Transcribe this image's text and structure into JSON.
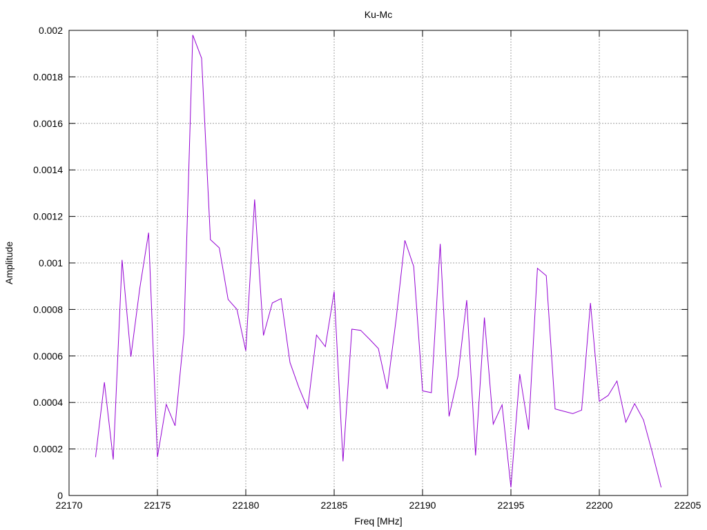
{
  "chart_data": {
    "type": "line",
    "title": "Ku-Mc",
    "xlabel": "Freq [MHz]",
    "ylabel": "Amplitude",
    "xlim": [
      22170,
      22205
    ],
    "ylim": [
      0,
      0.002
    ],
    "x_ticks": [
      "22170",
      "22175",
      "22180",
      "22185",
      "22190",
      "22195",
      "22200",
      "22205"
    ],
    "y_ticks": [
      "0",
      "0.0002",
      "0.0004",
      "0.0006",
      "0.0008",
      "0.001",
      "0.0012",
      "0.0014",
      "0.0016",
      "0.0018",
      "0.002"
    ],
    "grid": true,
    "legend": "none",
    "line_color": "#9400d3",
    "series": [
      {
        "x": [
          22171.5,
          22172,
          22172.5,
          22173,
          22173.5,
          22174,
          22174.5,
          22175,
          22175.5,
          22176,
          22176.5,
          22177,
          22177.5,
          22178,
          22178.5,
          22179,
          22179.5,
          22180,
          22180.5,
          22181,
          22181.5,
          22182,
          22182.5,
          22183,
          22183.5,
          22184,
          22184.5,
          22185,
          22185.5,
          22186,
          22186.5,
          22187,
          22187.5,
          22188,
          22188.5,
          22189,
          22189.5,
          22190,
          22190.5,
          22191,
          22191.5,
          22192,
          22192.5,
          22193,
          22193.5,
          22194,
          22194.5,
          22195,
          22195.5,
          22196,
          22196.5,
          22197,
          22197.5,
          22198,
          22198.5,
          22199,
          22199.5,
          22200,
          22200.5,
          22201,
          22201.5,
          22202,
          22202.5,
          22203,
          22203.5
        ],
        "y": [
          0.000165,
          0.000487,
          0.000155,
          0.001013,
          0.000597,
          0.00089,
          0.00113,
          0.000165,
          0.000392,
          0.0003,
          0.000695,
          0.00198,
          0.00188,
          0.0011,
          0.001065,
          0.000843,
          0.0008,
          0.000622,
          0.001273,
          0.000688,
          0.000828,
          0.000847,
          0.000572,
          0.000465,
          0.000374,
          0.00069,
          0.00064,
          0.000877,
          0.000147,
          0.000715,
          0.00071,
          0.000672,
          0.000632,
          0.000458,
          0.000755,
          0.001097,
          0.000985,
          0.00045,
          0.000442,
          0.001082,
          0.00034,
          0.000512,
          0.00084,
          0.000172,
          0.000765,
          0.000307,
          0.00039,
          3.5e-05,
          0.000522,
          0.000283,
          0.000977,
          0.000945,
          0.000372,
          0.000362,
          0.000352,
          0.000367,
          0.000828,
          0.000405,
          0.00043,
          0.000492,
          0.000315,
          0.000395,
          0.000325,
          0.000185,
          3.5e-05
        ]
      }
    ]
  }
}
